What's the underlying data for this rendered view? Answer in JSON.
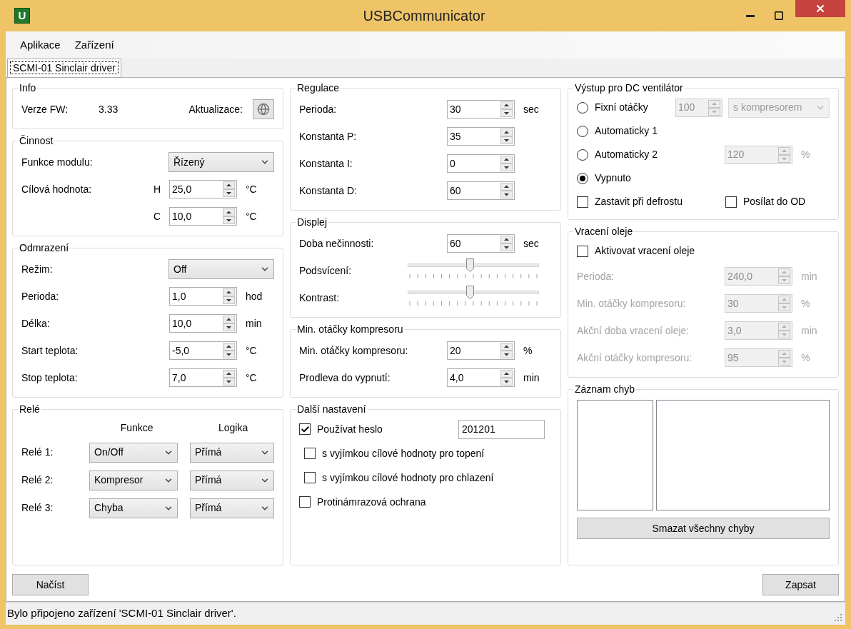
{
  "window": {
    "title": "USBCommunicator",
    "app_icon_letter": "U"
  },
  "menu": [
    {
      "label": "Aplikace"
    },
    {
      "label": "Zařízení"
    }
  ],
  "tabs": [
    {
      "label": "SCMI-01 Sinclair driver",
      "selected": true
    }
  ],
  "columns": [
    {
      "groups": [
        {
          "title": "Info",
          "rows": [
            {
              "kind": "info",
              "label": "Verze FW:",
              "value": "3.33",
              "action": "Aktualizace:"
            }
          ]
        },
        {
          "title": "Činnost",
          "rows": [
            {
              "kind": "select",
              "label": "Funkce modulu:",
              "value": "Řízený"
            },
            {
              "kind": "spin",
              "label": "Cílová hodnota:",
              "prefix": "H",
              "value": "25,0",
              "unit": "°C",
              "disabled": false
            },
            {
              "kind": "spin",
              "prefix": "C",
              "value": "10,0",
              "unit": "°C",
              "disabled": false
            }
          ]
        },
        {
          "title": "Odmrazení",
          "rows": [
            {
              "kind": "select",
              "label": "Režim:",
              "value": "Off"
            },
            {
              "kind": "spin",
              "label": "Perioda:",
              "value": "1,0",
              "unit": "hod",
              "disabled": false
            },
            {
              "kind": "spin",
              "label": "Délka:",
              "value": "10,0",
              "unit": "min",
              "disabled": false
            },
            {
              "kind": "spin",
              "label": "Start teplota:",
              "value": "-5,0",
              "unit": "°C",
              "disabled": false
            },
            {
              "kind": "spin",
              "label": "Stop teplota:",
              "value": "7,0",
              "unit": "°C",
              "disabled": false
            }
          ]
        },
        {
          "title": "Relé",
          "rows": [
            {
              "kind": "relay_header",
              "headers": [
                "Funkce",
                "Logika"
              ]
            },
            {
              "kind": "relay",
              "label": "Relé 1:",
              "function": "On/Off",
              "logic": "Přímá"
            },
            {
              "kind": "relay",
              "label": "Relé 2:",
              "function": "Kompresor",
              "logic": "Přímá"
            },
            {
              "kind": "relay",
              "label": "Relé 3:",
              "function": "Chyba",
              "logic": "Přímá"
            }
          ]
        }
      ]
    },
    {
      "groups": [
        {
          "title": "Regulace",
          "rows": [
            {
              "kind": "spin",
              "label": "Perioda:",
              "value": "30",
              "unit": "sec",
              "disabled": false
            },
            {
              "kind": "spin",
              "label": "Konstanta P:",
              "value": "35",
              "disabled": false
            },
            {
              "kind": "spin",
              "label": "Konstanta I:",
              "value": "0",
              "disabled": false
            },
            {
              "kind": "spin",
              "label": "Konstanta D:",
              "value": "60",
              "disabled": false
            }
          ]
        },
        {
          "title": "Displej",
          "rows": [
            {
              "kind": "spin",
              "label": "Doba nečinnosti:",
              "value": "60",
              "unit": "sec",
              "disabled": false
            },
            {
              "kind": "slider",
              "label": "Podsvícení:",
              "level": 0.47
            },
            {
              "kind": "slider",
              "label": "Kontrast:",
              "level": 0.47
            }
          ]
        },
        {
          "title": "Min. otáčky kompresoru",
          "rows": [
            {
              "kind": "spin",
              "label": "Min. otáčky kompresoru:",
              "value": "20",
              "unit": "%",
              "disabled": false
            },
            {
              "kind": "spin",
              "label": "Prodleva do vypnutí:",
              "value": "4,0",
              "unit": "min",
              "disabled": false
            }
          ]
        },
        {
          "title": "Další nastavení",
          "rows": [
            {
              "kind": "checkbox",
              "label": "Používat heslo",
              "checked": true,
              "field": "201201",
              "children": [
                {
                  "kind": "checkbox",
                  "label": "s vyjímkou cílové hodnoty pro topení",
                  "checked": false
                },
                {
                  "kind": "checkbox",
                  "label": "s vyjímkou cílové hodnoty pro chlazení",
                  "checked": false
                }
              ]
            },
            {
              "kind": "checkbox",
              "label": "Protinámrazová ochrana",
              "checked": false
            }
          ]
        }
      ]
    },
    {
      "groups": [
        {
          "title": "Výstup pro DC ventilátor",
          "rows": [
            {
              "kind": "radio",
              "label": "Fixní otáčky",
              "selected": false,
              "spin": {
                "value": "100",
                "disabled": true
              },
              "select": {
                "value": "s kompresorem",
                "disabled": true
              }
            },
            {
              "kind": "radio",
              "label": "Automaticky 1",
              "selected": false
            },
            {
              "kind": "radio",
              "label": "Automaticky 2",
              "selected": false,
              "spin": {
                "value": "120",
                "disabled": true
              },
              "unit": "%"
            },
            {
              "kind": "radio",
              "label": "Vypnuto",
              "selected": true
            },
            {
              "kind": "checkbox_pair",
              "items": [
                {
                  "label": "Zastavit při defrostu",
                  "checked": false
                },
                {
                  "label": "Posílat do OD",
                  "checked": false
                }
              ]
            }
          ]
        },
        {
          "title": "Vracení oleje",
          "rows": [
            {
              "kind": "checkbox",
              "label": "Aktivovat vracení oleje",
              "checked": false
            },
            {
              "kind": "spin",
              "label": "Perioda:",
              "value": "240,0",
              "unit": "min",
              "disabled": true
            },
            {
              "kind": "spin",
              "label": "Min. otáčky kompresoru:",
              "value": "30",
              "unit": "%",
              "disabled": true
            },
            {
              "kind": "spin",
              "label": "Akční doba vracení oleje:",
              "value": "3,0",
              "unit": "min",
              "disabled": true
            },
            {
              "kind": "spin",
              "label": "Akční otáčky kompresoru:",
              "value": "95",
              "unit": "%",
              "disabled": true
            }
          ]
        },
        {
          "title": "Záznam chyb",
          "rows": [
            {
              "kind": "error_log",
              "button": "Smazat všechny chyby"
            }
          ]
        }
      ]
    }
  ],
  "buttons": [
    {
      "label": "Načíst"
    },
    {
      "label": "Zapsat"
    }
  ],
  "status_bar": {
    "text": "Bylo připojeno zařízení 'SCMI-01 Sinclair driver'."
  }
}
